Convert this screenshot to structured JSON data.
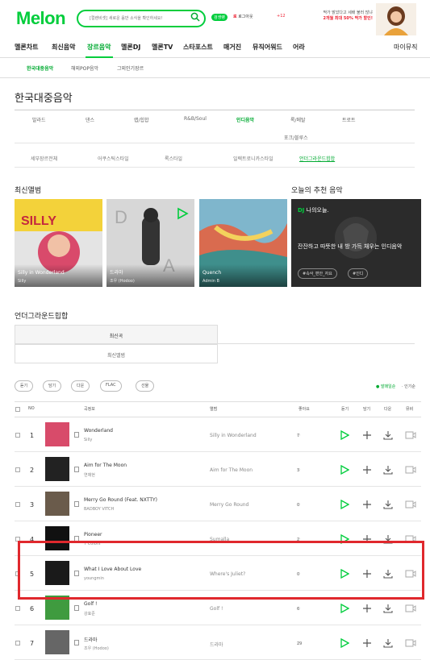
{
  "header": {
    "logo": "Melon",
    "search_placeholder": "[컬렌비셋] 새로운 음반 소식을 확인하세요!",
    "vip_badge": "검생랭",
    "login_text": "로그아웃",
    "login_user": "로",
    "mp3_label": "+12",
    "ad_line1": "딱가 밝았다고 세배 불러 많냐",
    "ad_line2": "2개월 최대 50% 딱가 할인!"
  },
  "gnb": [
    "멜론차트",
    "최신음악",
    "장르음악",
    "멜론DJ",
    "멜론TV",
    "스타포스트",
    "매거진",
    "뮤직어워드",
    "어라",
    "마이뮤직"
  ],
  "gnb_active": "장르음악",
  "subgnb": [
    "한국대중음악",
    "해외POP음악",
    "그외인기장르"
  ],
  "page_title": "한국대중음악",
  "genre_tabs": [
    "발라드",
    "댄스",
    "랩/힙합",
    "R&B/Soul",
    "인디음악",
    "록/메탈",
    "트로트",
    "포크/블루스"
  ],
  "genre_active": "인디음악",
  "sub_genres": [
    "세부장르전체",
    "어쿠스틱스타일",
    "록스타일",
    "일렉트로니카스타일",
    "언더그라운드힙합"
  ],
  "sub_genre_active": "언더그라운드힙합",
  "latest_albums_title": "최신앨범",
  "albums": [
    {
      "title": "Silly in Wonderland",
      "artist": "Silly"
    },
    {
      "title": "드라마",
      "artist": "조우 (Hodoo)"
    },
    {
      "title": "Quench",
      "artist": "Admin B"
    }
  ],
  "recommend_title": "오늘의 추천 음악",
  "dj": {
    "label": "DJ",
    "sub": "나의오늘.",
    "text": "잔잔하고 따뜻한 내 방 가득 채우는 인디음악",
    "tags": [
      "#속삭_편안_자요",
      "#인디"
    ]
  },
  "section2_title": "언더그라운드힙합",
  "list_tabs": [
    "최신곡",
    "최신앨범"
  ],
  "toolbar": [
    "듣기",
    "담기",
    "다운",
    "FLAC",
    "선물"
  ],
  "formats": {
    "active": "● 발매일순",
    "other": "· 인기순"
  },
  "table_headers": {
    "no": "NO",
    "song": "곡정보",
    "album": "앨범",
    "like": "좋아요",
    "play": "듣기",
    "add": "담기",
    "down": "다운",
    "mv": "뮤비"
  },
  "songs": [
    {
      "no": "1",
      "title": "Wonderland",
      "artist": "Silly",
      "album": "Silly in Wonderland",
      "like": "7"
    },
    {
      "no": "2",
      "title": "Aim for The Moon",
      "artist": "연채현",
      "album": "Aim for The Moon",
      "like": "3"
    },
    {
      "no": "3",
      "title": "Merry Go Round (Feat. NXTTY)",
      "artist": "BADBOY VITCH",
      "album": "Merry Go Round",
      "like": "0"
    },
    {
      "no": "4",
      "title": "Pioneer",
      "artist": "7 Colors",
      "album": "Sumalla",
      "like": "2"
    },
    {
      "no": "5",
      "title": "What I Love About Love",
      "artist": "youngmin",
      "album": "Where's Juliet?",
      "like": "0"
    },
    {
      "no": "6",
      "title": "Golf !",
      "artist": "강효준",
      "album": "Golf !",
      "like": "6"
    },
    {
      "no": "7",
      "title": "드라마",
      "artist": "조우 (Hodoo)",
      "album": "드라마",
      "like": "29"
    }
  ],
  "colors": {
    "brand": "#00cd3c",
    "highlight": "#e0282d"
  }
}
